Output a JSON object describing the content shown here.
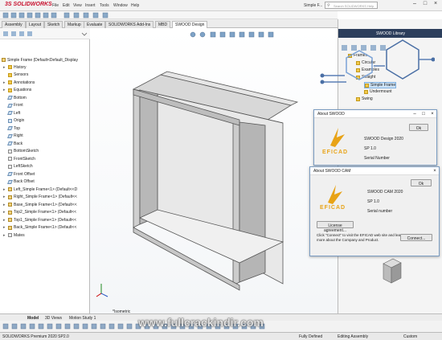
{
  "app": {
    "logo": "3S SOLIDWORKS"
  },
  "menu": [
    "File",
    "Edit",
    "View",
    "Insert",
    "Tools",
    "Window",
    "Help"
  ],
  "doc_title": "Simple F...",
  "search_placeholder": "Search SOLIDWORKS Help",
  "tabs": [
    "Assembly",
    "Layout",
    "Sketch",
    "Markup",
    "Evaluate",
    "SOLIDWORKS Add-Ins",
    "MBD",
    "SWOOD Design"
  ],
  "tree": {
    "root": "Simple Frame  (Default<Default_Display",
    "items": [
      {
        "label": "History",
        "icon": "folder-icon",
        "arrow": "▸"
      },
      {
        "label": "Sensors",
        "icon": "folder-icon",
        "arrow": ""
      },
      {
        "label": "Annotations",
        "icon": "folder-icon",
        "arrow": "▸"
      },
      {
        "label": "Equations",
        "icon": "folder-icon",
        "arrow": "▸"
      },
      {
        "label": "Bottom",
        "icon": "plane-icon",
        "arrow": ""
      },
      {
        "label": "Front",
        "icon": "plane-icon",
        "arrow": ""
      },
      {
        "label": "Left",
        "icon": "plane-icon",
        "arrow": ""
      },
      {
        "label": "Origin",
        "icon": "origin-icon",
        "arrow": ""
      },
      {
        "label": "Top",
        "icon": "plane-icon",
        "arrow": ""
      },
      {
        "label": "Right",
        "icon": "plane-icon",
        "arrow": ""
      },
      {
        "label": "Back",
        "icon": "plane-icon",
        "arrow": ""
      },
      {
        "label": "BottomSketch",
        "icon": "sketch-icon",
        "arrow": ""
      },
      {
        "label": "FrontSketch",
        "icon": "sketch-icon",
        "arrow": ""
      },
      {
        "label": "LeftSketch",
        "icon": "sketch-icon",
        "arrow": ""
      },
      {
        "label": "Front Offset",
        "icon": "plane-icon",
        "arrow": ""
      },
      {
        "label": "Back Offset",
        "icon": "plane-icon",
        "arrow": ""
      },
      {
        "label": "Left_Simple Frame<1> (Default<<D",
        "icon": "part-icon",
        "arrow": "▸"
      },
      {
        "label": "Right_Simple Frame<1> (Default<<",
        "icon": "part-icon",
        "arrow": "▸"
      },
      {
        "label": "Base_Simple Frame<1> (Default<<",
        "icon": "part-icon",
        "arrow": "▸"
      },
      {
        "label": "Top2_Simple Frame<1> (Default<<",
        "icon": "part-icon",
        "arrow": "▸"
      },
      {
        "label": "Top1_Simple Frame<1> (Default<<",
        "icon": "part-icon",
        "arrow": "▸"
      },
      {
        "label": "Back_Simple Frame<1> (Default<<",
        "icon": "part-icon",
        "arrow": "▸"
      },
      {
        "label": "Mates",
        "icon": "mates-icon",
        "arrow": "▸"
      }
    ]
  },
  "viewport": {
    "view_label": "*Isometric"
  },
  "library": {
    "title": "SWOOD Library",
    "items": [
      {
        "label": "Frames",
        "indent": 0
      },
      {
        "label": "Circular",
        "indent": 1
      },
      {
        "label": "Examples",
        "indent": 1
      },
      {
        "label": "Straight",
        "indent": 1
      },
      {
        "label": "Simple Frame",
        "indent": 2,
        "selected": true
      },
      {
        "label": "Undermount",
        "indent": 2
      },
      {
        "label": "Swing",
        "indent": 1
      }
    ]
  },
  "about_swood": {
    "title": "About SWOOD",
    "product": "SWOOD Design 2020",
    "sp": "SP 1.0",
    "serial_label": "Serial Number",
    "ok": "Ok",
    "logo": "EFICAD"
  },
  "about_cam": {
    "title": "About SWOOD CAM",
    "product": "SWOOD CAM 2020",
    "sp": "SP 1.0",
    "serial_label": "Serial number",
    "ok": "Ok",
    "logo": "EFICAD",
    "license_button": "License agreement...",
    "info": "Click \"Connect\" to visit the EFICAD web site and learn more about the Company and Product.",
    "connect_button": "Connect..."
  },
  "bottom_tabs": [
    "Model",
    "3D Views",
    "Motion Study 1"
  ],
  "status": {
    "left": "SOLIDWORKS Premium 2020 SP2.0",
    "fully_defined": "Fully Defined",
    "editing": "Editing Assembly",
    "custom": "Custom"
  },
  "watermark": "www.fullcrackindir.com",
  "colors": {
    "accent": "#c8102e",
    "eficad_gold": "#e8a317",
    "panel_header": "#2c3e5c"
  }
}
